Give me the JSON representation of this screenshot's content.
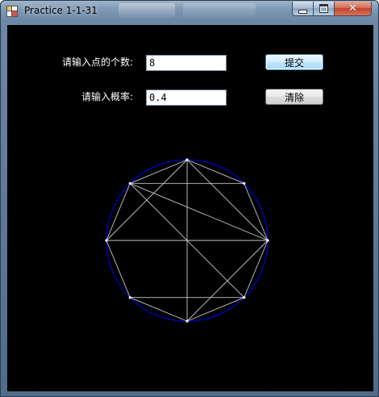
{
  "window": {
    "title": "Practice 1-1-31",
    "icon": "app-window-icon",
    "controls": {
      "minimize_icon": "minimize-icon",
      "maximize_icon": "maximize-icon",
      "close_icon": "close-icon",
      "close_glyph": "✕"
    }
  },
  "form": {
    "points_label": "请输入点的个数:",
    "points_value": "8",
    "probability_label": "请输入概率:",
    "probability_value": "0.4",
    "submit_label": "提交",
    "clear_label": "清除"
  },
  "graph": {
    "point_count": 8,
    "circle_color": "#0000cc",
    "edge_color": "#c8c8c8",
    "point_color": "#ffffff",
    "edges": [
      [
        0,
        1
      ],
      [
        1,
        2
      ],
      [
        2,
        3
      ],
      [
        3,
        4
      ],
      [
        4,
        5
      ],
      [
        5,
        6
      ],
      [
        6,
        7
      ],
      [
        7,
        0
      ],
      [
        6,
        2
      ],
      [
        6,
        4
      ],
      [
        5,
        1
      ],
      [
        5,
        0
      ],
      [
        4,
        0
      ],
      [
        3,
        1
      ],
      [
        2,
        0
      ],
      [
        0,
        6
      ],
      [
        7,
        5
      ]
    ]
  }
}
